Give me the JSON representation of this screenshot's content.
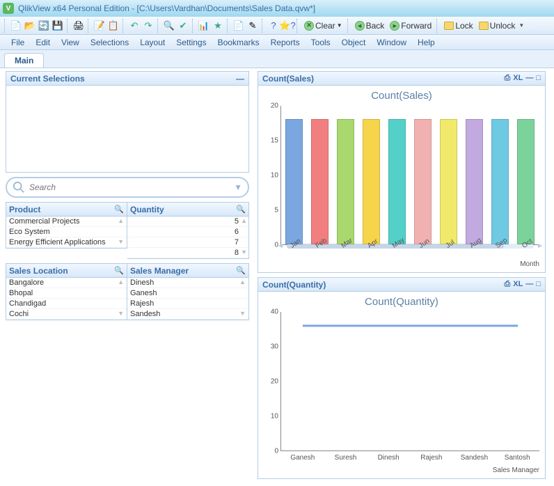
{
  "window": {
    "title": "QlikView x64 Personal Edition - [C:\\Users\\Vardhan\\Documents\\Sales Data.qvw*]",
    "app_letter": "V"
  },
  "toolbar": {
    "clear": "Clear",
    "back": "Back",
    "forward": "Forward",
    "lock": "Lock",
    "unlock": "Unlock"
  },
  "menu": [
    "File",
    "Edit",
    "View",
    "Selections",
    "Layout",
    "Settings",
    "Bookmarks",
    "Reports",
    "Tools",
    "Object",
    "Window",
    "Help"
  ],
  "tab": "Main",
  "cur_sel": {
    "title": "Current Selections"
  },
  "search": {
    "placeholder": "Search"
  },
  "listboxes": {
    "product": {
      "title": "Product",
      "items": [
        "Commercial Projects",
        "Eco System",
        "Energy Efficient Applications"
      ]
    },
    "quantity": {
      "title": "Quantity",
      "items": [
        "5",
        "6",
        "7",
        "8"
      ]
    },
    "location": {
      "title": "Sales Location",
      "items": [
        "Bangalore",
        "Bhopal",
        "Chandigad",
        "Cochi"
      ]
    },
    "manager": {
      "title": "Sales Manager",
      "items": [
        "Dinesh",
        "Ganesh",
        "Rajesh",
        "Sandesh"
      ]
    }
  },
  "chart1": {
    "header": "Count(Sales)",
    "title": "Count(Sales)",
    "xlabel": "Month",
    "xl_badge": "XL"
  },
  "chart2": {
    "header": "Count(Quantity)",
    "title": "Count(Quantity)",
    "xlabel": "Sales Manager",
    "xl_badge": "XL"
  },
  "chart_data": [
    {
      "type": "bar",
      "title": "Count(Sales)",
      "xlabel": "Month",
      "ylabel": "",
      "ylim": [
        0,
        20
      ],
      "yticks": [
        0,
        5,
        10,
        15,
        20
      ],
      "categories": [
        "Jan",
        "Feb",
        "Mar",
        "Apr",
        "May",
        "Jun",
        "Jul",
        "Aug",
        "Sep",
        "Oct"
      ],
      "values": [
        18,
        18,
        18,
        18,
        18,
        18,
        18,
        18,
        18,
        18
      ],
      "colors": [
        "#7aa7e0",
        "#f27f7f",
        "#a9d86e",
        "#f6d44b",
        "#53d1c9",
        "#f2b1b1",
        "#f1e96a",
        "#c2a9e0",
        "#6fc9e3",
        "#7cd29b"
      ]
    },
    {
      "type": "line",
      "title": "Count(Quantity)",
      "xlabel": "Sales Manager",
      "ylabel": "",
      "ylim": [
        0,
        40
      ],
      "yticks": [
        0,
        10,
        20,
        30,
        40
      ],
      "categories": [
        "Ganesh",
        "Suresh",
        "Dinesh",
        "Rajesh",
        "Sandesh",
        "Santosh"
      ],
      "values": [
        36,
        36,
        36,
        36,
        36,
        36
      ],
      "color": "#7aa7e0"
    }
  ]
}
